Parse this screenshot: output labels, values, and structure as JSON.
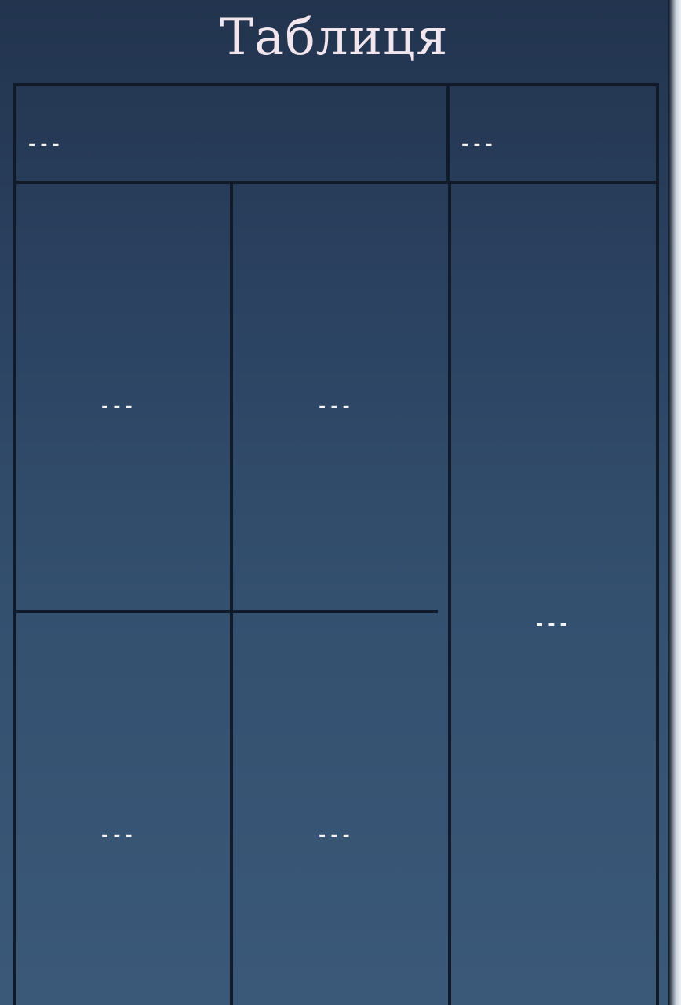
{
  "table": {
    "title": "Таблиця",
    "header_cells": [
      "---",
      "---"
    ],
    "body_cells": {
      "left_top": "---",
      "middle_top": "---",
      "right_tall": "---",
      "left_bottom": "---",
      "middle_bottom": "---"
    }
  },
  "colors": {
    "background": "#2b4261",
    "grid_line": "#111a29",
    "text": "#f4f4f6"
  }
}
